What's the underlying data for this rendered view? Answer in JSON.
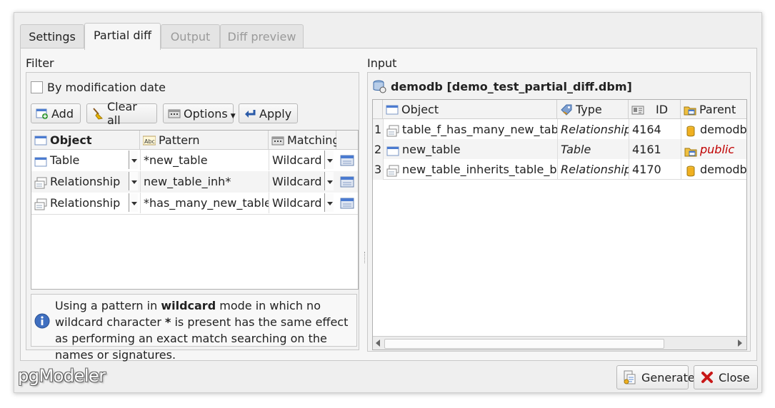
{
  "tabs": [
    {
      "label": "Settings",
      "state": "normal"
    },
    {
      "label": "Partial diff",
      "state": "active"
    },
    {
      "label": "Output",
      "state": "disabled"
    },
    {
      "label": "Diff preview",
      "state": "disabled"
    }
  ],
  "filter": {
    "title": "Filter",
    "by_mod_date": {
      "label": "By modification date",
      "checked": false
    },
    "buttons": {
      "add": "Add",
      "clear_all": "Clear all",
      "options": "Options",
      "apply": "Apply"
    },
    "columns": {
      "object": "Object",
      "pattern": "Pattern",
      "matching": "Matching"
    },
    "rows": [
      {
        "object": "Table",
        "pattern": "*new_table",
        "matching": "Wildcard",
        "icon": "table-icon"
      },
      {
        "object": "Relationship",
        "pattern": "new_table_inh*",
        "matching": "Wildcard",
        "icon": "relationship-icon"
      },
      {
        "object": "Relationship",
        "pattern": "*has_many_new_table*",
        "matching": "Wildcard",
        "icon": "relationship-icon"
      }
    ],
    "info": {
      "pre": "Using a pattern in ",
      "bold1": "wildcard",
      "mid": " mode in which no wildcard character ",
      "bold2": "*",
      "post": " is present has the same effect as performing an exact match searching on the names or signatures."
    }
  },
  "input": {
    "title": "Input",
    "db_label": "demodb [demo_test_partial_diff.dbm]",
    "columns": {
      "object": "Object",
      "type": "Type",
      "id": "ID",
      "parent": "Parent"
    },
    "rows": [
      {
        "num": "1",
        "object": "table_f_has_many_new_table",
        "type": "Relationship",
        "id": "4164",
        "parent": "demodb",
        "parent_style": "normal"
      },
      {
        "num": "2",
        "object": "new_table",
        "type": "Table",
        "id": "4161",
        "parent": "public",
        "parent_style": "red"
      },
      {
        "num": "3",
        "object": "new_table_inherits_table_b",
        "type": "Relationship",
        "id": "4170",
        "parent": "demodb",
        "parent_style": "normal"
      }
    ]
  },
  "footer": {
    "logo": "pgModeler",
    "generate_label": "Generate",
    "close_label": "Close"
  }
}
